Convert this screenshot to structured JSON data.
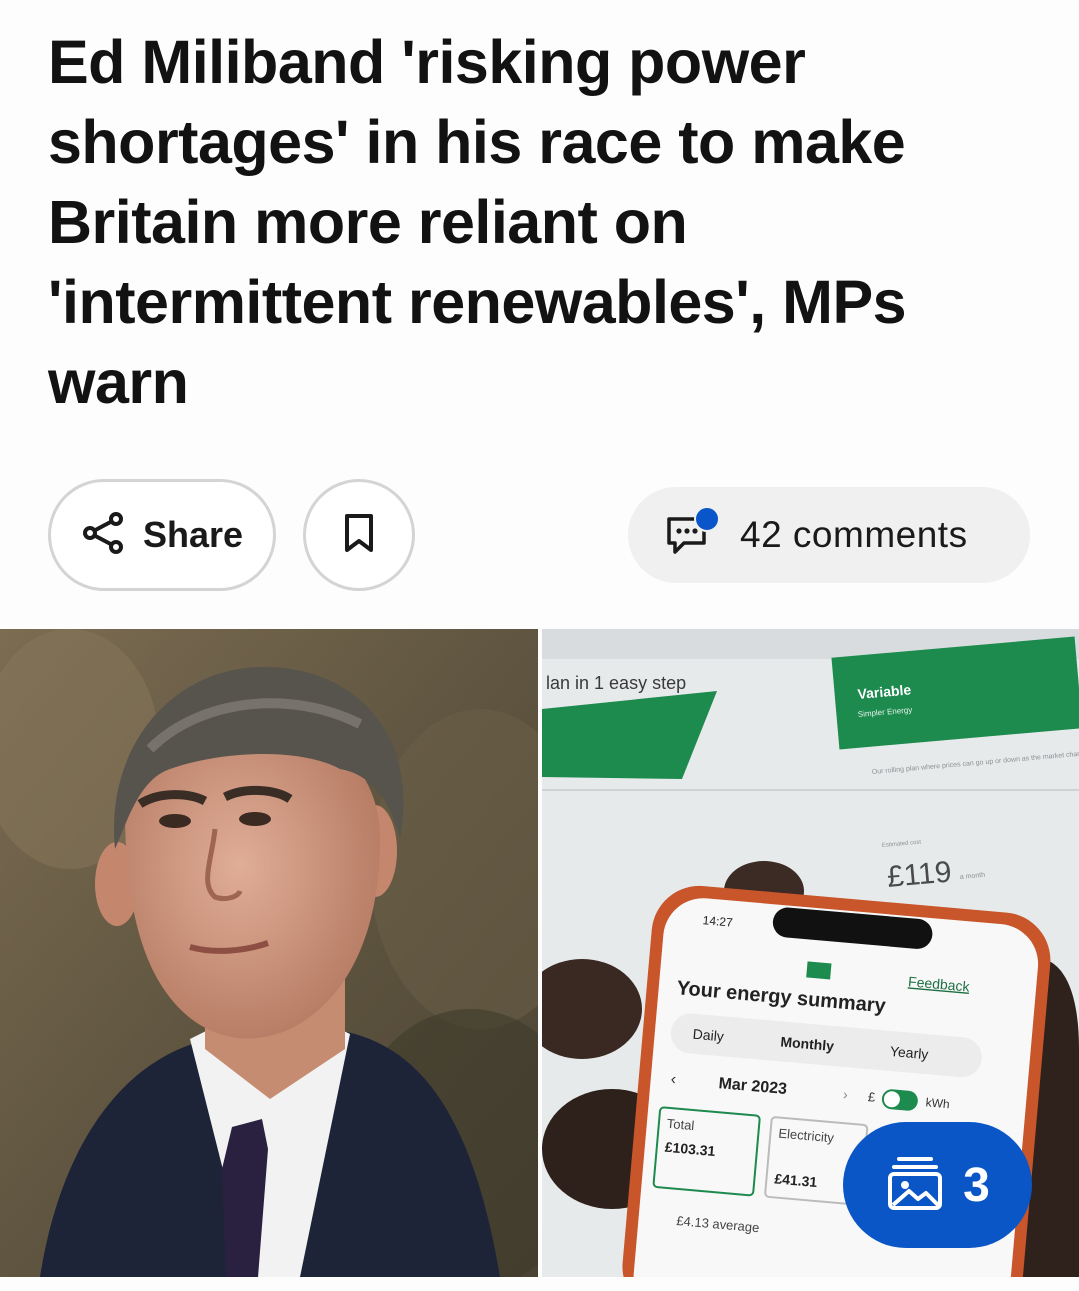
{
  "article": {
    "headline": "Ed Miliband 'risking power shortages' in his race to make Britain more reliant on 'intermittent renewables', MPs warn"
  },
  "actions": {
    "share_label": "Share",
    "comments_label": "42 comments"
  },
  "gallery": {
    "count": "3"
  },
  "images": {
    "right": {
      "web_heading": "lan in 1 easy step",
      "web_card_title": "Variable",
      "web_card_subtitle": "Simpler Energy",
      "web_card_desc": "Our rolling plan where prices can go up or down as the market changes.",
      "web_price_label": "Estimated cost",
      "web_price": "£119",
      "web_price_unit": "a month",
      "phone_time": "14:27",
      "phone_feedback": "Feedback",
      "phone_title": "Your energy summary",
      "phone_tabs": [
        "Daily",
        "Monthly",
        "Yearly"
      ],
      "phone_month": "Mar 2023",
      "phone_toggle_left": "£",
      "phone_toggle_right": "kWh",
      "phone_total_label": "Total",
      "phone_total_value": "£103.31",
      "phone_elec_label": "Electricity",
      "phone_elec_value": "£41.31",
      "phone_average": "£4.13 average"
    }
  },
  "colors": {
    "accent": "#0b56c7",
    "brand_green": "#1d8a4e"
  }
}
